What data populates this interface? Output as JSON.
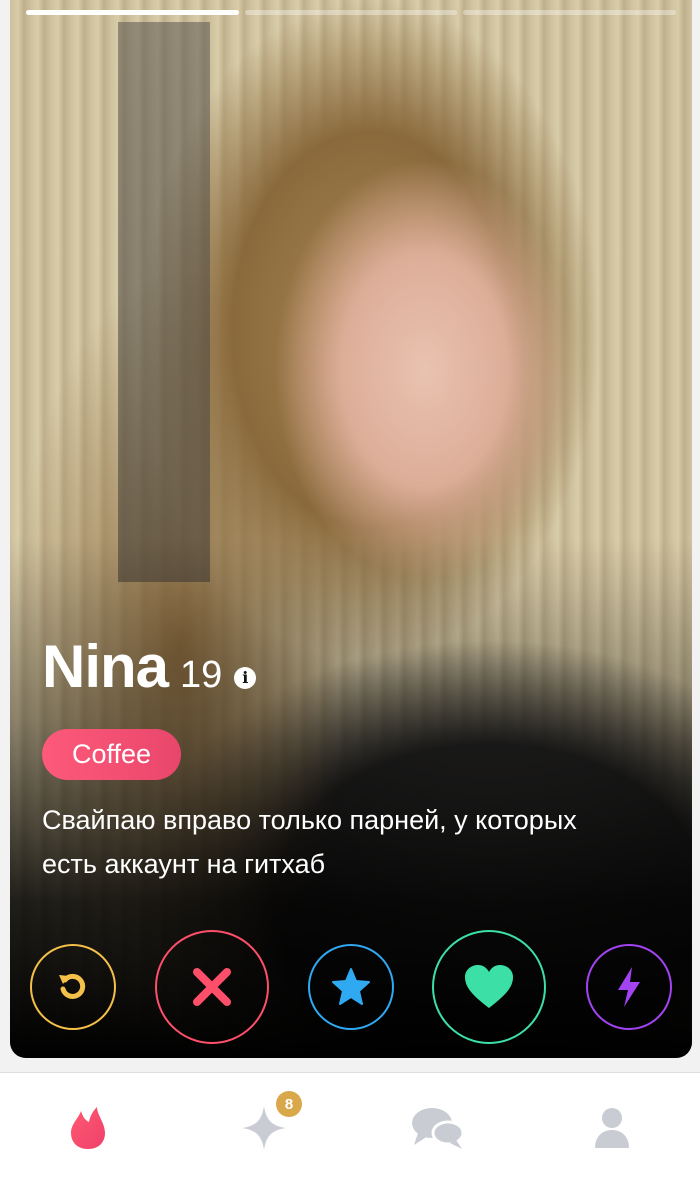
{
  "profile": {
    "name": "Nina",
    "age": "19",
    "info_glyph": "i",
    "interest_badge": "Coffee",
    "bio": "Свайпаю вправо только парней, у которых есть аккаунт на гитхаб",
    "photo_progress": {
      "current": 1,
      "total": 3
    }
  },
  "actions": [
    {
      "id": "rewind",
      "icon": "rewind-icon",
      "color": "#f5c04a"
    },
    {
      "id": "nope",
      "icon": "close-icon",
      "color": "#fe4f6a"
    },
    {
      "id": "super-like",
      "icon": "star-icon",
      "color": "#2fa9f1"
    },
    {
      "id": "like",
      "icon": "heart-icon",
      "color": "#3ce0a6"
    },
    {
      "id": "boost",
      "icon": "lightning-icon",
      "color": "#a244f2"
    }
  ],
  "tabbar": {
    "items": [
      {
        "id": "home",
        "icon": "flame-icon",
        "active": true
      },
      {
        "id": "top-picks",
        "icon": "sparkle-icon",
        "badge": "8"
      },
      {
        "id": "messages",
        "icon": "chat-icon"
      },
      {
        "id": "profile",
        "icon": "user-icon"
      }
    ]
  },
  "colors": {
    "brand": "#fd5a7a",
    "badge_gold": "#d9a84a",
    "tab_inactive": "#c9ccd2"
  }
}
